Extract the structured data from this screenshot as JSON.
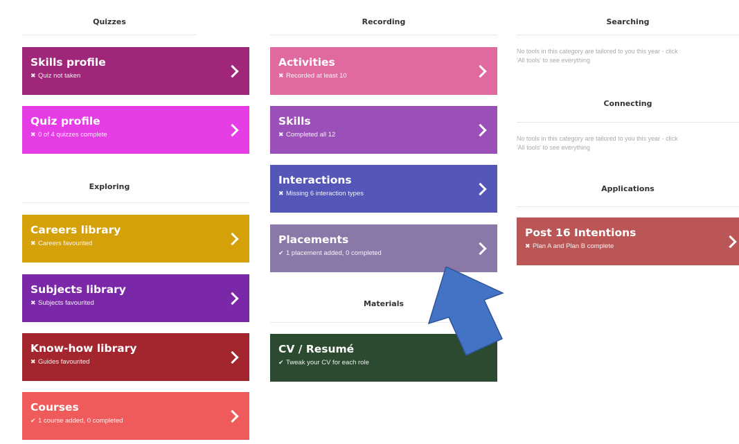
{
  "columns": {
    "col1": {
      "quizzes_title": "Quizzes",
      "quizzes": [
        {
          "title": "Skills profile",
          "status": "Quiz not taken",
          "icon": "cross-icon",
          "color": "#a0267a"
        },
        {
          "title": "Quiz profile",
          "status": "0 of 4 quizzes complete",
          "icon": "cross-icon",
          "color": "#e63ce6"
        }
      ],
      "exploring_title": "Exploring",
      "exploring": [
        {
          "title": "Careers library",
          "status": "Careers favourited",
          "icon": "cross-icon",
          "color": "#d4a10a"
        },
        {
          "title": "Subjects library",
          "status": "Subjects favourited",
          "icon": "cross-icon",
          "color": "#7a28a8"
        },
        {
          "title": "Know-how library",
          "status": "Guides favourited",
          "icon": "cross-icon",
          "color": "#a3262e"
        },
        {
          "title": "Courses",
          "status": "1 course added, 0 completed",
          "icon": "check-icon",
          "color": "#ef5a5a"
        }
      ]
    },
    "col2": {
      "recording_title": "Recording",
      "recording": [
        {
          "title": "Activities",
          "status": "Recorded at least 10",
          "icon": "cross-icon",
          "color": "#e06aa0"
        },
        {
          "title": "Skills",
          "status": "Completed all 12",
          "icon": "cross-icon",
          "color": "#9b4fb8"
        },
        {
          "title": "Interactions",
          "status": "Missing 6 interaction types",
          "icon": "cross-icon",
          "color": "#5557b8"
        },
        {
          "title": "Placements",
          "status": "1 placement added, 0 completed",
          "icon": "check-icon",
          "color": "#8a78a8"
        }
      ],
      "materials_title": "Materials",
      "materials": [
        {
          "title": "CV / Resumé",
          "status": "Tweak your CV for each role",
          "icon": "check-icon",
          "color": "#2b4a30"
        }
      ]
    },
    "col3": {
      "searching_title": "Searching",
      "searching_empty": [
        "No tools in this category are tailored to you this year - click",
        "'All tools' to see everything"
      ],
      "connecting_title": "Connecting",
      "connecting_empty": [
        "No tools in this category are tailored to you this year - click",
        "'All tools' to see everything"
      ],
      "applications_title": "Applications",
      "applications": [
        {
          "title": "Post 16 Intentions",
          "status": "Plan A and Plan B complete",
          "icon": "cross-icon",
          "color": "#bb5656"
        }
      ]
    }
  },
  "icons": {
    "cross-icon": "✖",
    "check-icon": "✔",
    "chevron": "chevron-right-icon"
  },
  "overlay": {
    "arrow_color": "#4472c4",
    "arrow_border": "#2f5597"
  }
}
